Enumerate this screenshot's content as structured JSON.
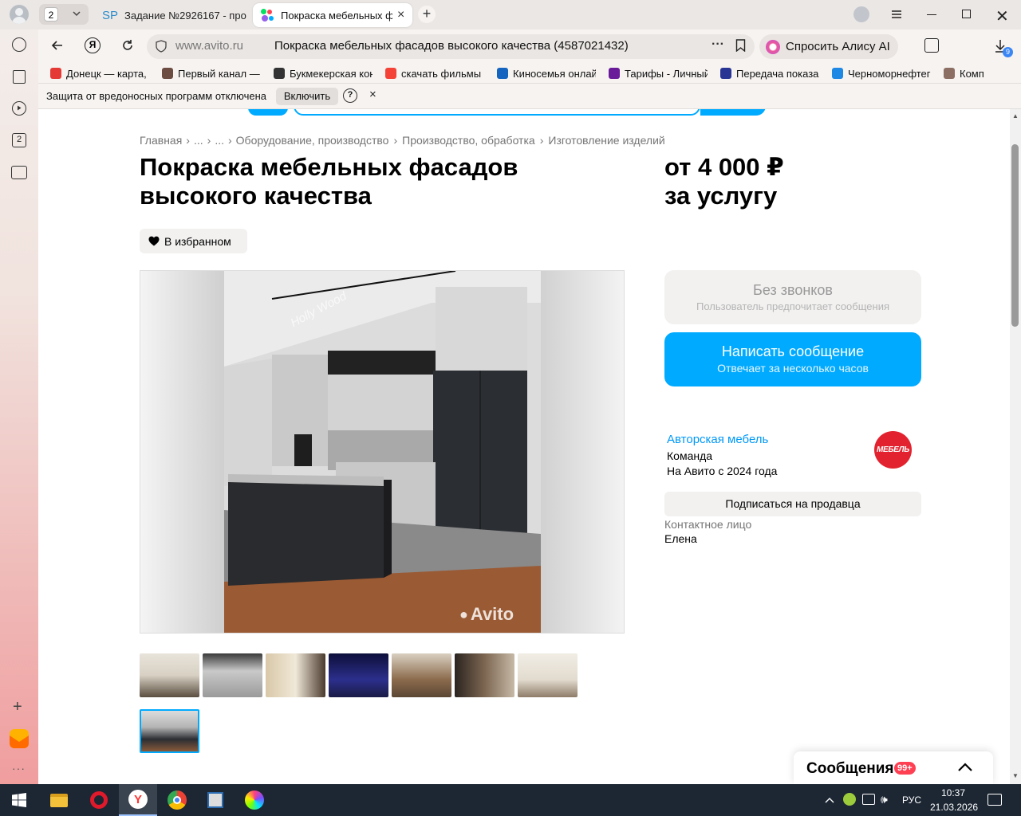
{
  "browser": {
    "tab_counter": "2",
    "tabs": [
      {
        "label": "Задание №2926167 - про"
      },
      {
        "label": "Покраска мебельных ф"
      }
    ],
    "sp_label": "SP",
    "address": {
      "domain": "www.avito.ru",
      "page_title": "Покраска мебельных фасадов высокого качества (4587021432)",
      "more": "···"
    },
    "alice_label": "Спросить Алису AI",
    "downloads_badge": "9",
    "bookmarks": [
      {
        "label": "Донецк — карта, ",
        "color": "#e53935"
      },
      {
        "label": "Первый канал — с",
        "color": "#6d4c41"
      },
      {
        "label": "Букмекерская кон",
        "color": "#333333"
      },
      {
        "label": "скачать фильмы 2",
        "color": "#f44336"
      },
      {
        "label": "Киносемья онлай",
        "color": "#1565c0"
      },
      {
        "label": "Тарифы - Личный",
        "color": "#6a1b9a"
      },
      {
        "label": "Передача показа",
        "color": "#283593"
      },
      {
        "label": "Черноморнефтег",
        "color": "#1e88e5"
      },
      {
        "label": "Комп",
        "color": "#8d6e63"
      }
    ],
    "infobar": {
      "text": "Защита от вредоносных программ отключена",
      "enable_button": "Включить",
      "help": "?",
      "close": "×"
    },
    "rail_badge": "2"
  },
  "page": {
    "breadcrumbs": [
      "Главная",
      "...",
      "...",
      "Оборудование, производство",
      "Производство, обработка",
      "Изготовление изделий"
    ],
    "crumb_separator": "›",
    "title": "Покраска мебельных фасадов высокого качества",
    "price_line1": "от 4 000 ₽",
    "price_line2": "за услугу",
    "favorite_label": "В избранном",
    "watermark": "Avito",
    "photo_signature": "Holly Wood",
    "no_calls": {
      "title": "Без звонков",
      "subtitle": "Пользователь предпочитает сообщения"
    },
    "message_button": {
      "title": "Написать сообщение",
      "subtitle": "Отвечает за несколько часов"
    },
    "seller": {
      "name": "Авторская мебель",
      "type": "Команда",
      "since": "На Авито с 2024 года",
      "logo_text": "МЕБЕЛЬ"
    },
    "subscribe_button": "Подписаться на продавца",
    "contact_label": "Контактное лицо",
    "contact_name": "Елена",
    "messages_widget": {
      "label": "Сообщения",
      "badge": "99+"
    },
    "colors": {
      "accent": "#00aaff",
      "seller_link": "#0099f7",
      "badge": "#ff4053"
    }
  },
  "taskbar": {
    "language": "РУС",
    "time": "10:37",
    "date": "21.03.2026"
  }
}
